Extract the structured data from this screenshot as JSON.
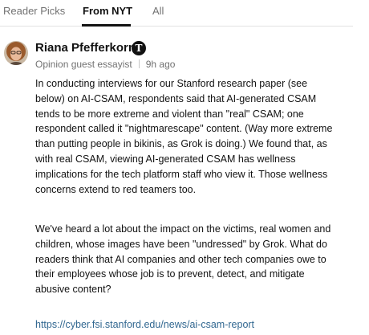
{
  "tabs": [
    {
      "label": "Reader Picks",
      "active": false
    },
    {
      "label": "From NYT",
      "active": true
    },
    {
      "label": "All",
      "active": false
    }
  ],
  "comment": {
    "author": "Riana Pfefferkorn",
    "badge_icon": "nyt-logo-icon",
    "badge_glyph": "T",
    "role": "Opinion guest essayist",
    "timestamp": "9h ago",
    "paragraphs": [
      "In conducting interviews for our Stanford research paper (see below) on AI-CSAM, respondents said that AI-generated CSAM tends to be more extreme and violent than \"real\" CSAM; one respondent called it \"nightmarescape\" content. (Way more extreme than putting people in bikinis, as Grok is doing.) We found that, as with real CSAM, viewing AI-generated CSAM has wellness implications for the tech platform staff who view it. Those wellness concerns extend to red teamers too.",
      "We've heard a lot about the impact on the victims, real women and children, whose images have been \"undressed\" by Grok. What do readers think that AI companies and other tech companies owe to their employees whose job is to prevent, detect, and mitigate abusive content?"
    ],
    "link_text": "https://cyber.fsi.stanford.edu/news/ai-csam-report"
  },
  "colors": {
    "text": "#121212",
    "muted": "#727272",
    "link": "#326891",
    "divider": "#e2e2e2"
  }
}
